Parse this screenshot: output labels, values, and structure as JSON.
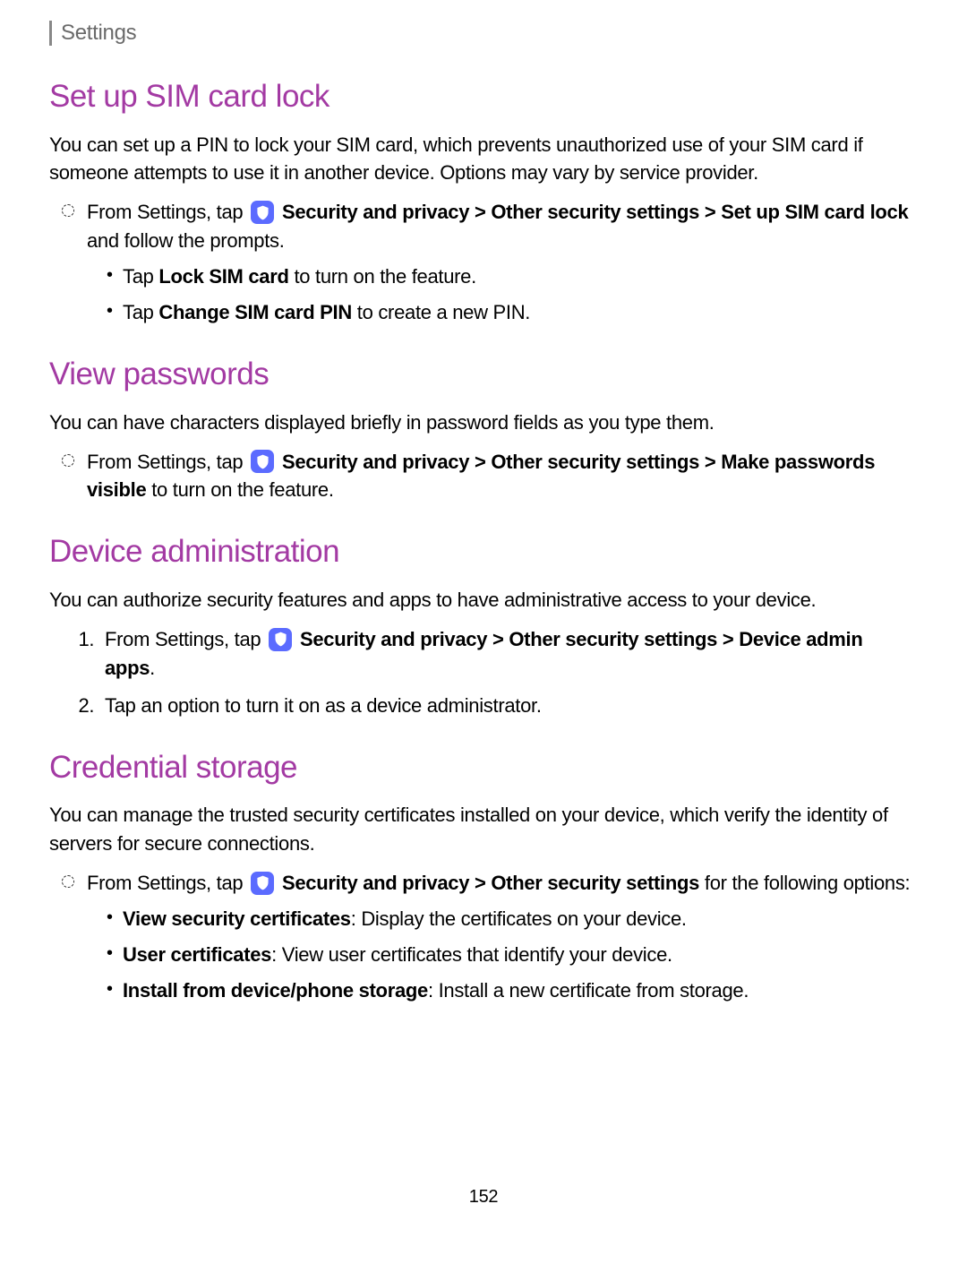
{
  "breadcrumb": "Settings",
  "sections": {
    "sim": {
      "heading": "Set up SIM card lock",
      "intro": "You can set up a PIN to lock your SIM card, which prevents unauthorized use of your SIM card if someone attempts to use it in another device. Options may vary by service provider.",
      "step_prefix": "From Settings, tap ",
      "step_strong": "Security and privacy > Other security settings > Set up SIM card lock",
      "step_suffix": " and follow the prompts.",
      "sub1_pre": "Tap ",
      "sub1_strong": "Lock SIM card",
      "sub1_suf": " to turn on the feature.",
      "sub2_pre": "Tap ",
      "sub2_strong": "Change SIM card PIN",
      "sub2_suf": " to create a new PIN."
    },
    "view": {
      "heading": "View passwords",
      "intro": "You can have characters displayed briefly in password fields as you type them.",
      "step_prefix": "From Settings, tap ",
      "step_strong": "Security and privacy > Other security settings > Make passwords visible",
      "step_suffix": " to turn on the feature."
    },
    "admin": {
      "heading": "Device administration",
      "intro": "You can authorize security features and apps to have administrative access to your device.",
      "step1_prefix": "From Settings, tap ",
      "step1_strong": "Security and privacy > Other security settings > Device admin apps",
      "step1_suffix": ".",
      "step2": "Tap an option to turn it on as a device administrator."
    },
    "cred": {
      "heading": "Credential storage",
      "intro": "You can manage the trusted security certificates installed on your device, which verify the identity of servers for secure connections.",
      "step_prefix": "From Settings, tap ",
      "step_strong": "Security and privacy > Other security settings",
      "step_suffix": " for the following options:",
      "opt1_strong": "View security certificates",
      "opt1_suf": ": Display the certificates on your device.",
      "opt2_strong": "User certificates",
      "opt2_suf": ": View user certificates that identify your device.",
      "opt3_strong": "Install from device/phone storage",
      "opt3_suf": ": Install a new certificate from storage."
    }
  },
  "page_number": "152"
}
